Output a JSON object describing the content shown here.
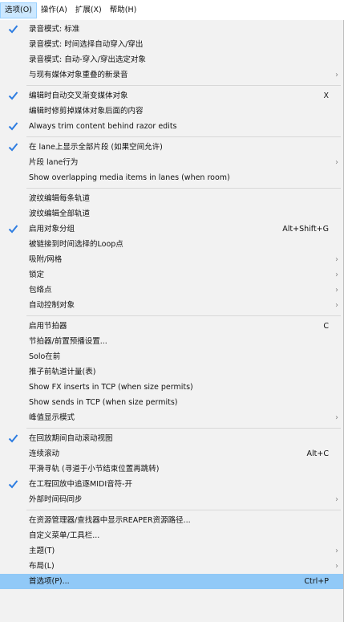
{
  "menubar": [
    {
      "label": "选项(O)",
      "active": true
    },
    {
      "label": "操作(A)"
    },
    {
      "label": "扩展(X)"
    },
    {
      "label": "帮助(H)"
    }
  ],
  "menu_items": [
    {
      "label": "录音模式: 标准",
      "checked": true
    },
    {
      "label": "录音模式: 时间选择自动穿入/穿出"
    },
    {
      "label": "录音模式: 自动-穿入/穿出选定对象"
    },
    {
      "label": "与现有媒体对象重叠的新录音",
      "submenu": true
    },
    {
      "sep": true
    },
    {
      "label": "编辑时自动交叉渐变媒体对象",
      "checked": true,
      "shortcut": "X"
    },
    {
      "label": "编辑时修剪掉媒体对象后面的内容"
    },
    {
      "label": "Always trim content behind razor edits",
      "checked": true
    },
    {
      "sep": true
    },
    {
      "label": "在 lane上显示全部片段 (如果空间允许)",
      "checked": true
    },
    {
      "label": "片段 lane行为",
      "submenu": true
    },
    {
      "label": "Show overlapping media items in lanes (when room)"
    },
    {
      "sep": true
    },
    {
      "label": "波纹编辑每条轨道"
    },
    {
      "label": "波纹编辑全部轨道"
    },
    {
      "label": "启用对象分组",
      "checked": true,
      "shortcut": "Alt+Shift+G"
    },
    {
      "label": "被链接到时间选择的Loop点"
    },
    {
      "label": "吸附/网格",
      "submenu": true
    },
    {
      "label": "锁定",
      "submenu": true
    },
    {
      "label": "包络点",
      "submenu": true
    },
    {
      "label": "自动控制对象",
      "submenu": true
    },
    {
      "sep": true
    },
    {
      "label": "启用节拍器",
      "shortcut": "C"
    },
    {
      "label": "节拍器/前置预播设置..."
    },
    {
      "label": "Solo在前"
    },
    {
      "label": "推子前轨道计量(表)"
    },
    {
      "label": "Show FX inserts in TCP (when size permits)"
    },
    {
      "label": "Show sends in TCP (when size permits)"
    },
    {
      "label": "峰值显示模式",
      "submenu": true
    },
    {
      "sep": true
    },
    {
      "label": "在回放期间自动滚动视图",
      "checked": true
    },
    {
      "label": "连续滚动",
      "shortcut": "Alt+C"
    },
    {
      "label": "平滑寻轨 (寻道于小节结束位置再跳转)"
    },
    {
      "label": "在工程回放中追逐MIDI音符-开",
      "checked": true
    },
    {
      "label": "外部时间码同步",
      "submenu": true
    },
    {
      "sep": true
    },
    {
      "label": "在资源管理器/查找器中显示REAPER资源路径..."
    },
    {
      "label": "自定义菜单/工具栏..."
    },
    {
      "label": "主题(T)",
      "submenu": true
    },
    {
      "label": "布局(L)",
      "submenu": true
    },
    {
      "label": "首选项(P)...",
      "shortcut": "Ctrl+P",
      "highlighted": true
    }
  ],
  "icons": {
    "check": "checkmark-icon",
    "arrow": "chevron-right-icon"
  },
  "colors": {
    "check": "#2e7de1",
    "highlight": "#91c9f7",
    "menubar_active": "#cce8ff"
  }
}
